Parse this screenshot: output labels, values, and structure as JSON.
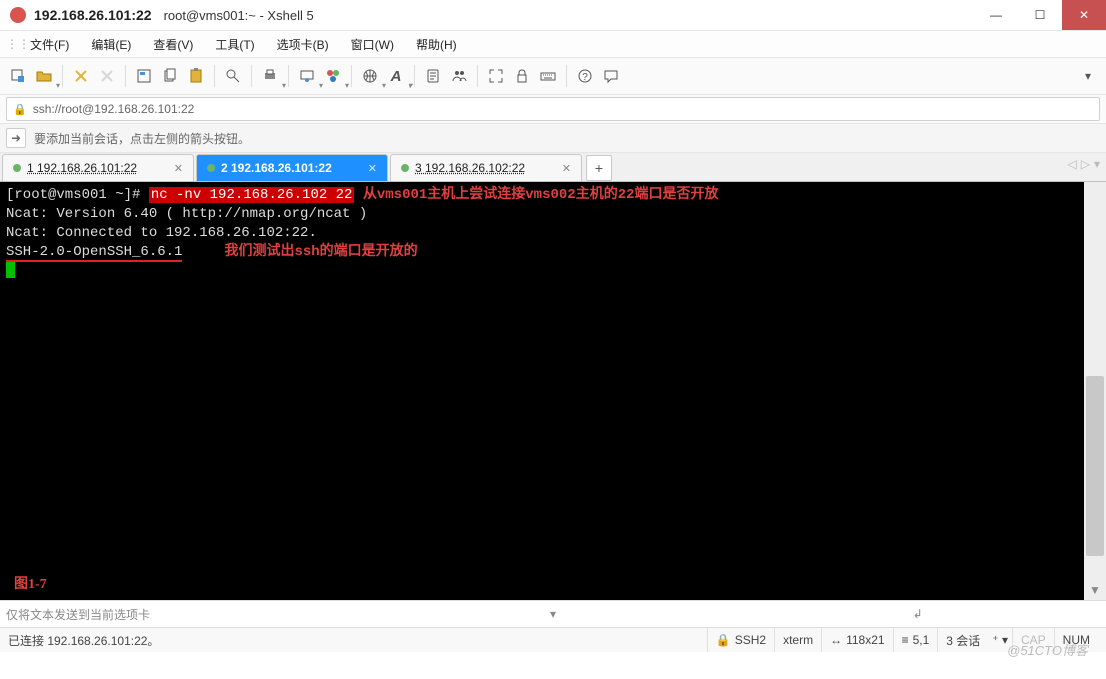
{
  "window": {
    "title_host": "192.168.26.101:22",
    "title_app": "root@vms001:~ - Xshell 5"
  },
  "menu": {
    "file": "文件(F)",
    "edit": "编辑(E)",
    "view": "查看(V)",
    "tools": "工具(T)",
    "tabs": "选项卡(B)",
    "window": "窗口(W)",
    "help": "帮助(H)"
  },
  "address": {
    "url": "ssh://root@192.168.26.101:22"
  },
  "hint": {
    "text": "要添加当前会话，点击左侧的箭头按钮。"
  },
  "tabs": {
    "t1": "1 192.168.26.101:22",
    "t2": "2 192.168.26.101:22",
    "t3": "3 192.168.26.102:22",
    "add": "+"
  },
  "terminal": {
    "prompt": "[root@vms001 ~]# ",
    "cmd": "nc -nv 192.168.26.102 22",
    "anno1": "从vms001主机上尝试连接vms002主机的22端口是否开放",
    "line2": "Ncat: Version 6.40 ( http://nmap.org/ncat )",
    "line3": "Ncat: Connected to 192.168.26.102:22.",
    "line4": "SSH-2.0-OpenSSH_6.6.1",
    "anno2": "我们测试出ssh的端口是开放的",
    "fig": "图1-7"
  },
  "sendbar": {
    "placeholder": "仅将文本发送到当前选项卡"
  },
  "status": {
    "conn": "已连接 192.168.26.101:22。",
    "proto": "SSH2",
    "term": "xterm",
    "size": "118x21",
    "pos": "5,1",
    "sessions": "3 会话",
    "caps": "CAP",
    "num": "NUM"
  },
  "watermark": "@51CTO博客"
}
